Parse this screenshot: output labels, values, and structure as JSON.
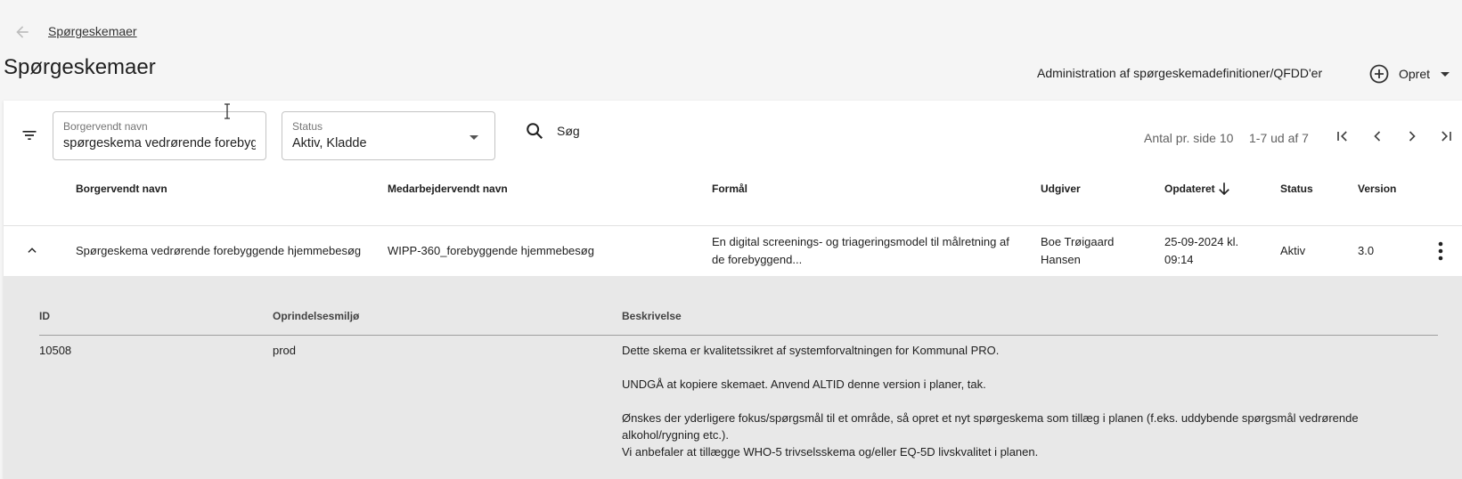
{
  "breadcrumb": {
    "label": "Spørgeskemaer"
  },
  "page": {
    "title": "Spørgeskemaer"
  },
  "header_actions": {
    "admin_link": "Administration af spørgeskemadefinitioner/QFDD'er",
    "create_label": "Opret"
  },
  "filters": {
    "name_label": "Borgervendt navn",
    "name_value": "spørgeskema vedrørende forebyggende",
    "status_label": "Status",
    "status_value": "Aktiv, Kladde",
    "search_label": "Søg"
  },
  "pagination": {
    "page_size_text": "Antal pr. side 10",
    "range_text": "1-7 ud af 7"
  },
  "table": {
    "headers": {
      "citizen_name": "Borgervendt navn",
      "staff_name": "Medarbejdervendt navn",
      "purpose": "Formål",
      "publisher": "Udgiver",
      "updated": "Opdateret",
      "status": "Status",
      "version": "Version"
    },
    "rows": [
      {
        "citizen_name": "Spørgeskema vedrørende forebyggende hjemmebesøg",
        "staff_name": "WIPP-360_forebyggende hjemmebesøg",
        "purpose_line1": "En digital screenings- og triageringsmodel til målretning af",
        "purpose_line2": "de forebyggend...",
        "publisher_line1": "Boe Trøigaard",
        "publisher_line2": "Hansen",
        "updated_line1": "25-09-2024 kl.",
        "updated_line2": "09:14",
        "status": "Aktiv",
        "version": "3.0"
      }
    ]
  },
  "detail": {
    "headers": {
      "id": "ID",
      "origin": "Oprindelsesmiljø",
      "description": "Beskrivelse"
    },
    "id": "10508",
    "origin": "prod",
    "description": {
      "p1": "Dette skema er kvalitetssikret af systemforvaltningen for Kommunal PRO.",
      "p2": "UNDGÅ at kopiere skemaet. Anvend ALTID denne version i planer, tak.",
      "p3a": "Ønskes der yderligere fokus/spørgsmål til et område, så opret et nyt spørgeskema som tillæg i planen (f.eks. uddybende spørgsmål vedrørende alkohol/rygning etc.).",
      "p3b": "Vi anbefaler at tillægge WHO-5 trivselsskema og/eller EQ-5D livskvalitet i planen."
    }
  },
  "icons": {
    "back": "arrow-left-icon",
    "create": "plus-circle-icon",
    "filter": "filter-list-icon",
    "search": "search-icon",
    "sort": "arrow-down-icon",
    "expand": "chevron-up-icon",
    "more": "more-vert-icon"
  },
  "colors": {
    "background": "#f5f5f5",
    "card": "#ffffff",
    "detail_bg": "#e8e8e8",
    "text": "#212121",
    "muted": "#757575"
  }
}
